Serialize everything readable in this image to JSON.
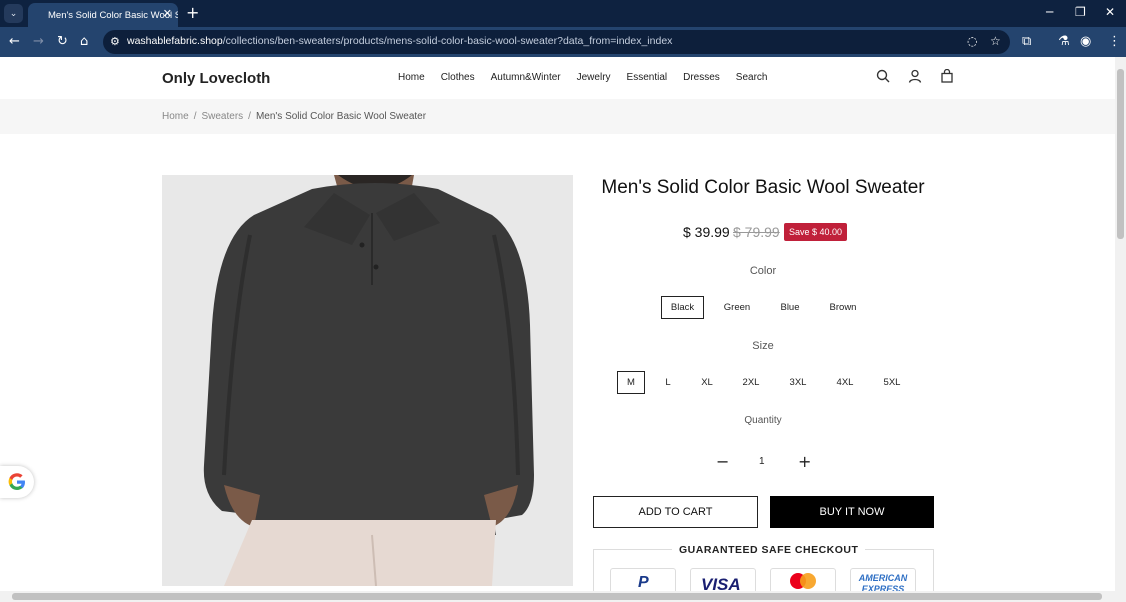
{
  "browser": {
    "tab_title": "Men's Solid Color Basic Wool S",
    "url_host": "washablefabric.shop",
    "url_path": "/collections/ben-sweaters/products/mens-solid-color-basic-wool-sweater?data_from=index_index"
  },
  "header": {
    "logo": "Only Lovecloth",
    "nav": [
      "Home",
      "Clothes",
      "Autumn&Winter",
      "Jewelry",
      "Essential",
      "Dresses",
      "Search"
    ]
  },
  "breadcrumb": {
    "home": "Home",
    "category": "Sweaters",
    "current": "Men's Solid Color Basic Wool Sweater",
    "separator": "/"
  },
  "product": {
    "title": "Men's Solid Color Basic Wool Sweater",
    "price": "$ 39.99",
    "old_price": "$ 79.99",
    "save": "Save $ 40.00",
    "color_label": "Color",
    "colors": [
      "Black",
      "Green",
      "Blue",
      "Brown"
    ],
    "selected_color": "Black",
    "size_label": "Size",
    "sizes": [
      "M",
      "L",
      "XL",
      "2XL",
      "3XL",
      "4XL",
      "5XL"
    ],
    "selected_size": "M",
    "quantity_label": "Quantity",
    "quantity": "1",
    "add_to_cart": "ADD TO CART",
    "buy_now": "BUY IT NOW",
    "checkout_title": "GUARANTEED SAFE CHECKOUT",
    "payments": [
      "PayPal",
      "VISA",
      "Mastercard",
      "AMERICAN EXPRESS"
    ]
  },
  "colors": {
    "chrome_dark": "#0e2240",
    "chrome_toolbar": "#24446e",
    "save_badge": "#c0203a",
    "sweater": "#3a3a3a"
  }
}
